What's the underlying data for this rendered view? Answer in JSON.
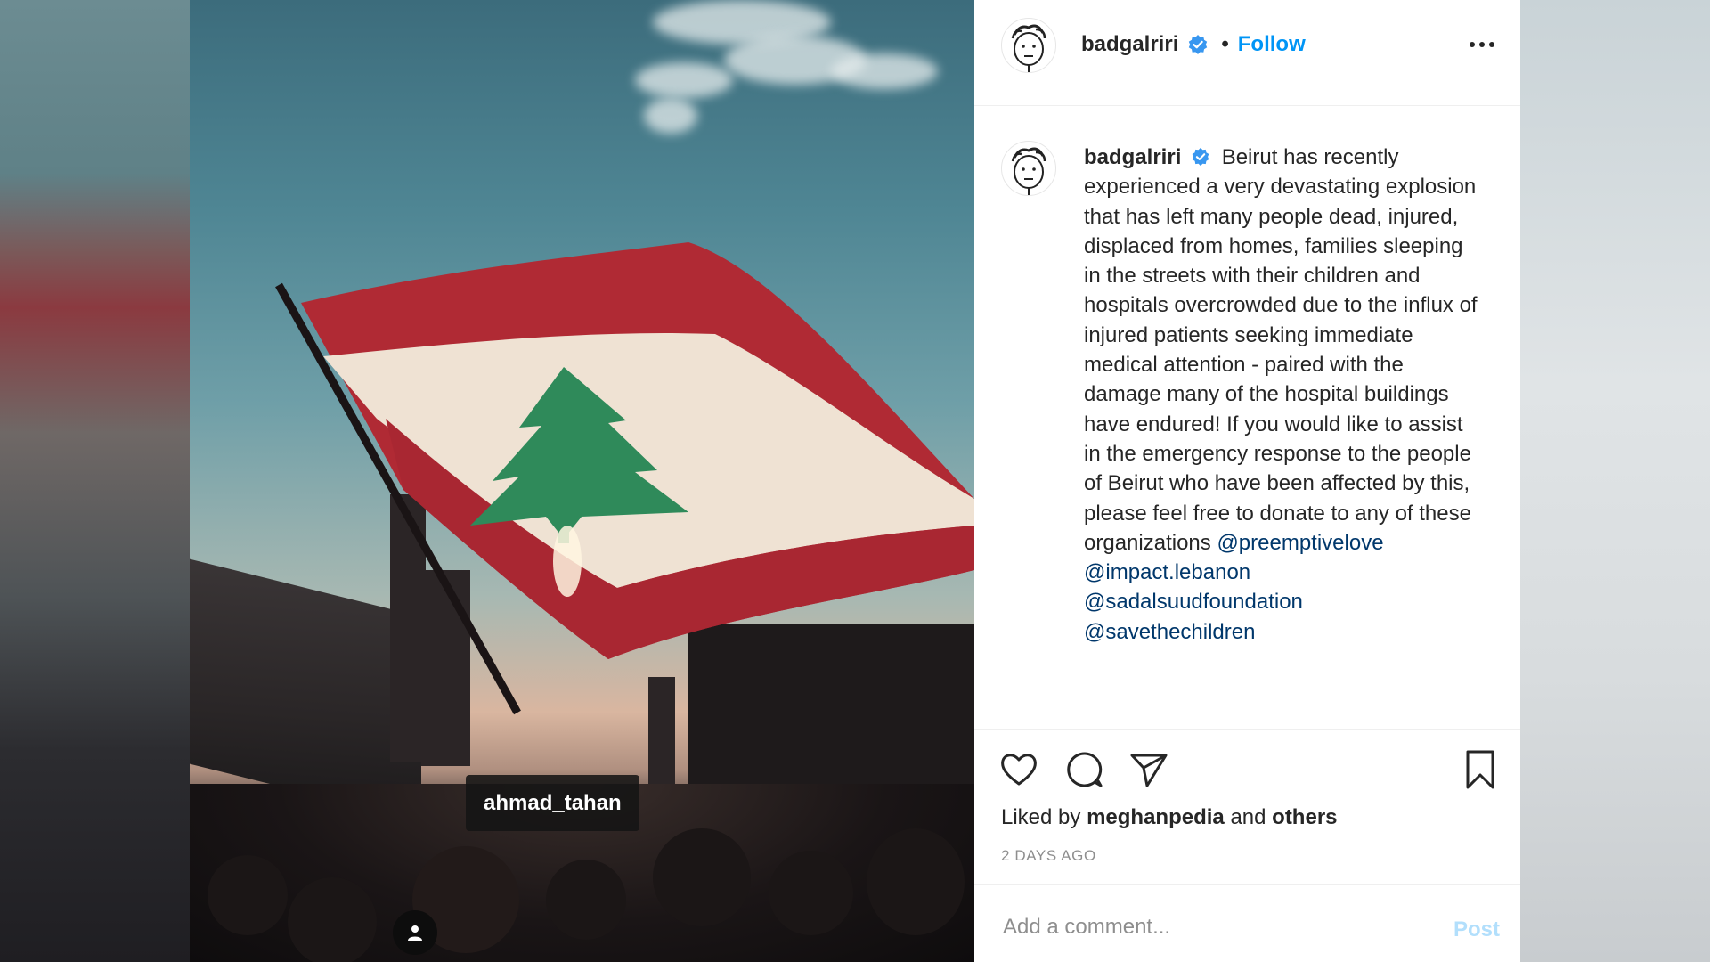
{
  "photo": {
    "user_tag": "ahmad_tahan"
  },
  "header": {
    "username": "badgalriri",
    "separator": "•",
    "follow_label": "Follow"
  },
  "caption": {
    "username": "badgalriri",
    "text": "Beirut has recently experienced a very devastating explosion that has left many people dead, injured, displaced from homes, families sleeping in the streets with their children and hospitals overcrowded due to the influx of injured patients seeking immediate medical attention - paired with the damage many of the hospital buildings have endured! If you would like to assist in the emergency response to the people of Beirut who have been affected by this, please feel free to donate to any of these organizations",
    "mentions": [
      "@preemptivelove",
      "@impact.lebanon",
      "@sadalsuudfoundation",
      "@savethechildren"
    ]
  },
  "likes": {
    "prefix": "Liked by",
    "user": "meghanpedia",
    "middle": "and",
    "others": "others"
  },
  "time_ago": "2 DAYS AGO",
  "comment": {
    "placeholder": "Add a comment...",
    "post_label": "Post"
  },
  "colors": {
    "accent": "#0095f6",
    "verified": "#3897f0",
    "mention": "#00376b",
    "post_disabled": "#b2dffc",
    "flag_red": "#c8283a",
    "cedar_green": "#2f8a5a"
  },
  "icons": [
    "verified-badge-icon",
    "more-options-icon",
    "heart-icon",
    "comment-icon",
    "share-icon",
    "bookmark-icon",
    "user-tag-icon"
  ]
}
